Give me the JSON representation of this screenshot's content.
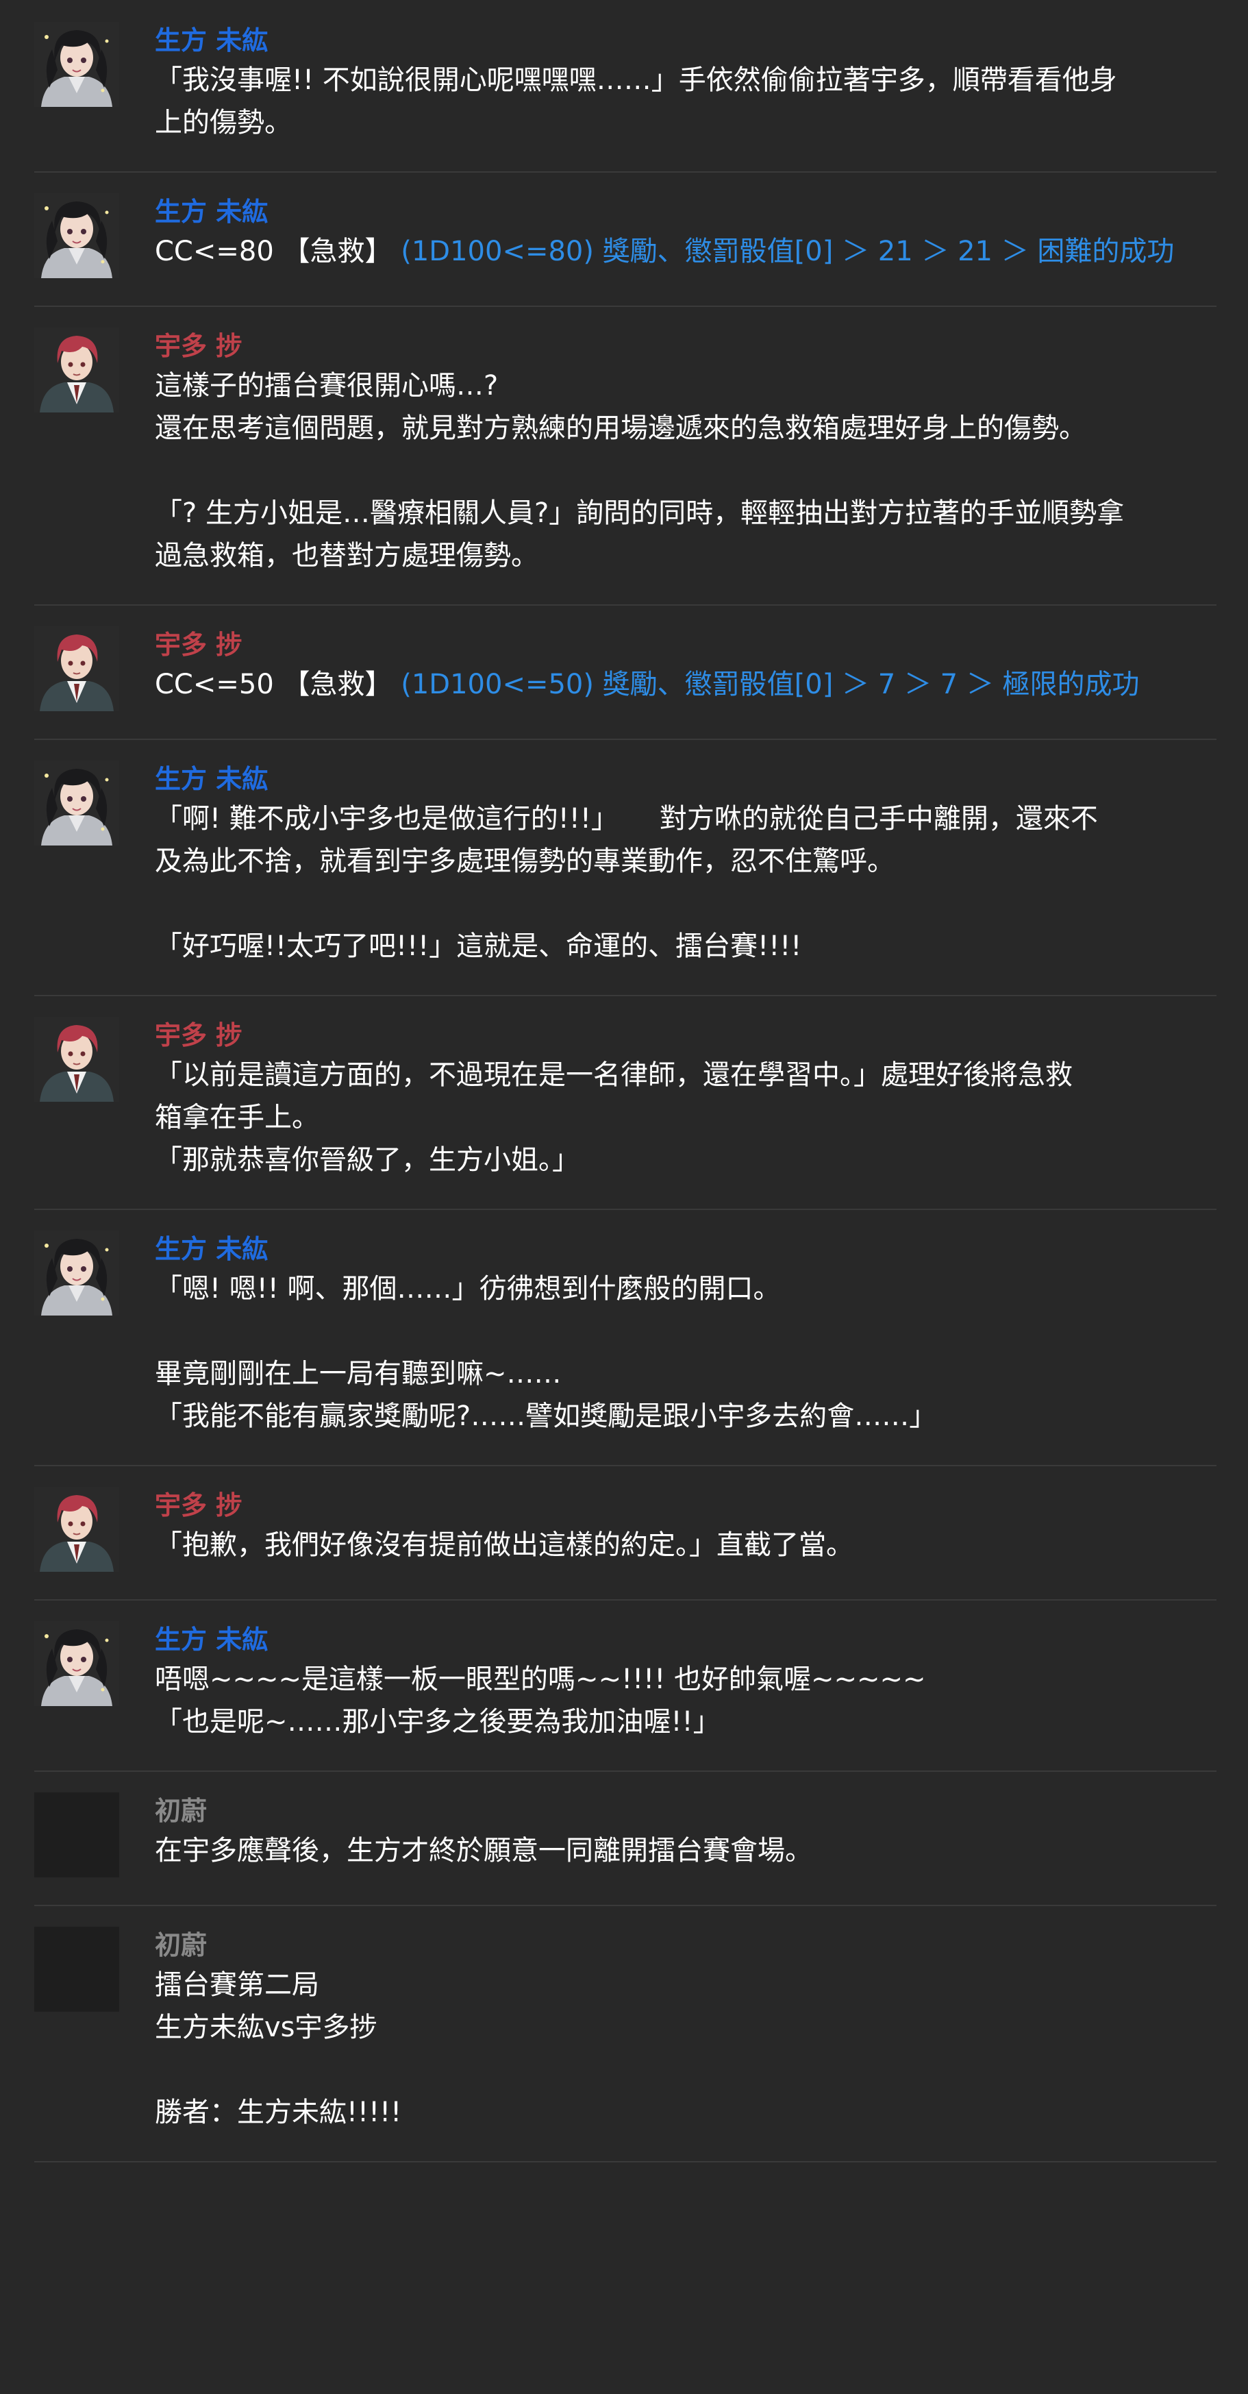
{
  "colors": {
    "background": "#282828",
    "divider": "#3a3a3a",
    "text": "#ffffff",
    "name_ubukata": "#1f6be0",
    "name_uta": "#c0414a",
    "name_gm": "#8a8a8a",
    "dice_result": "#2e8de6"
  },
  "messages": [
    {
      "speaker": "生方 未紘",
      "avatar": "ubukata-avatar",
      "text": "「我沒事喔!! 不如說很開心呢嘿嘿嘿……」手依然偷偷拉著宇多，順帶看看他身\n上的傷勢。"
    },
    {
      "speaker": "生方 未紘",
      "avatar": "ubukata-avatar",
      "command": "CC<=80 【急救】",
      "result": "(1D100<=80) 獎勵、懲罰骰值[0] ＞ 21 ＞ 21 ＞ 困難的成功"
    },
    {
      "speaker": "宇多 捗",
      "avatar": "uta-avatar",
      "text": "這樣子的擂台賽很開心嗎…?\n還在思考這個問題，就見對方熟練的用場邊遞來的急救箱處理好身上的傷勢。\n\n「? 生方小姐是…醫療相關人員?」詢問的同時，輕輕抽出對方拉著的手並順勢拿\n過急救箱，也替對方處理傷勢。"
    },
    {
      "speaker": "宇多 捗",
      "avatar": "uta-avatar",
      "command": "CC<=50 【急救】",
      "result": "(1D100<=50) 獎勵、懲罰骰值[0] ＞ 7 ＞ 7 ＞ 極限的成功"
    },
    {
      "speaker": "生方 未紘",
      "avatar": "ubukata-avatar",
      "text": "「啊! 難不成小宇多也是做這行的!!!」　　對方咻的就從自己手中離開，還來不\n及為此不捨，就看到宇多處理傷勢的專業動作，忍不住驚呼。\n\n「好巧喔!!太巧了吧!!!」這就是、命運的、擂台賽!!!!"
    },
    {
      "speaker": "宇多 捗",
      "avatar": "uta-avatar",
      "text": "「以前是讀這方面的，不過現在是一名律師，還在學習中。」處理好後將急救\n箱拿在手上。\n「那就恭喜你晉級了，生方小姐。」"
    },
    {
      "speaker": "生方 未紘",
      "avatar": "ubukata-avatar",
      "text": "「嗯! 嗯!! 啊、那個……」彷彿想到什麼般的開口。\n\n畢竟剛剛在上一局有聽到嘛~……\n「我能不能有贏家獎勵呢?……譬如獎勵是跟小宇多去約會……」"
    },
    {
      "speaker": "宇多 捗",
      "avatar": "uta-avatar",
      "text": "「抱歉，我們好像沒有提前做出這樣的約定。」直截了當。"
    },
    {
      "speaker": "生方 未紘",
      "avatar": "ubukata-avatar",
      "text": "唔嗯~~~~是這樣一板一眼型的嗎~~!!!! 也好帥氣喔~~~~~\n「也是呢~……那小宇多之後要為我加油喔!!」"
    },
    {
      "speaker": "初蔚",
      "avatar": "blank-avatar",
      "text": "在宇多應聲後，生方才終於願意一同離開擂台賽會場。"
    },
    {
      "speaker": "初蔚",
      "avatar": "blank-avatar",
      "text": "擂台賽第二局\n生方未紘vs宇多捗\n\n勝者：生方未紘!!!!!"
    }
  ]
}
